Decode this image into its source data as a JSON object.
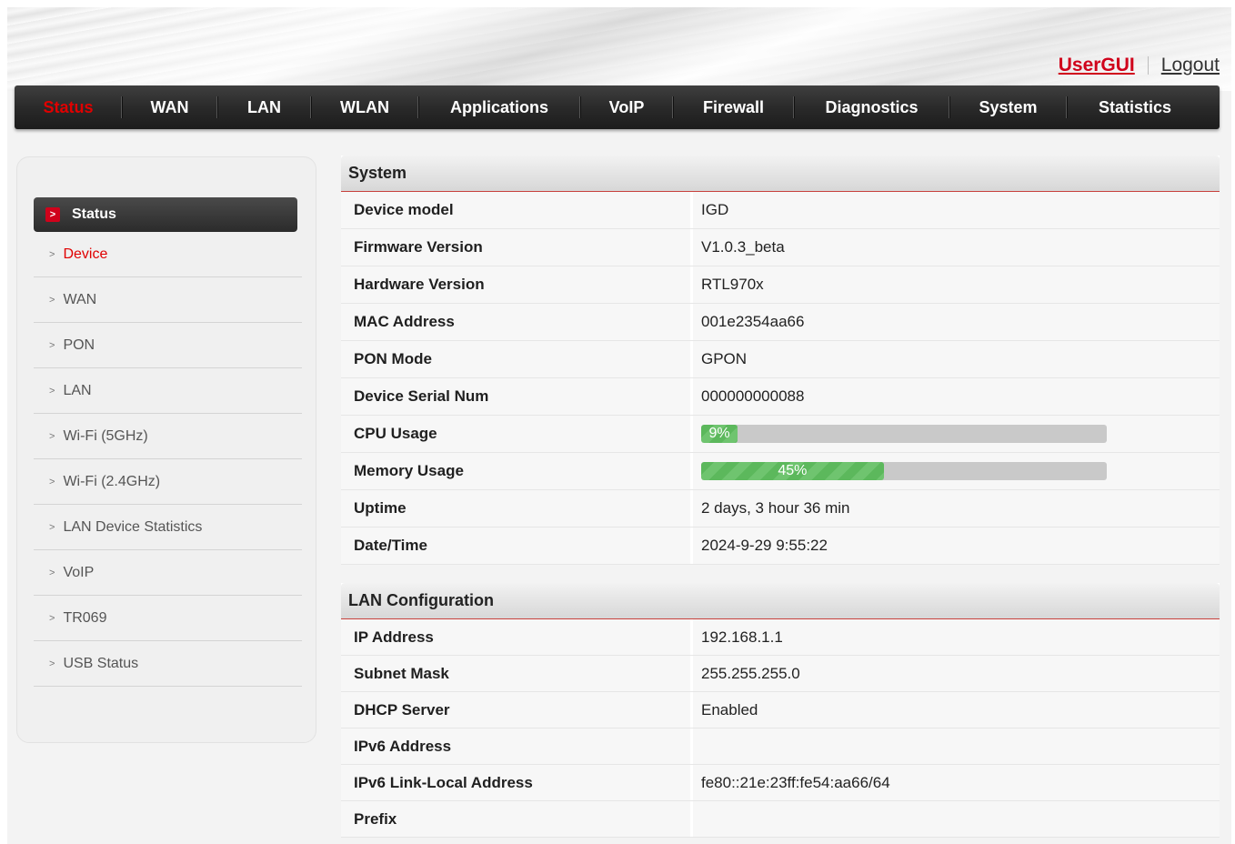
{
  "header": {
    "usergui_label": "UserGUI",
    "logout_label": "Logout"
  },
  "nav": {
    "items": [
      {
        "label": "Status",
        "active": true
      },
      {
        "label": "WAN"
      },
      {
        "label": "LAN"
      },
      {
        "label": "WLAN"
      },
      {
        "label": "Applications"
      },
      {
        "label": "VoIP"
      },
      {
        "label": "Firewall"
      },
      {
        "label": "Diagnostics"
      },
      {
        "label": "System"
      },
      {
        "label": "Statistics"
      }
    ]
  },
  "sidebar": {
    "heading": "Status",
    "items": [
      {
        "label": "Device",
        "active": true
      },
      {
        "label": "WAN"
      },
      {
        "label": "PON"
      },
      {
        "label": "LAN"
      },
      {
        "label": "Wi-Fi (5GHz)"
      },
      {
        "label": "Wi-Fi (2.4GHz)"
      },
      {
        "label": "LAN Device Statistics"
      },
      {
        "label": "VoIP"
      },
      {
        "label": "TR069"
      },
      {
        "label": "USB Status"
      }
    ]
  },
  "system": {
    "title": "System",
    "rows": [
      {
        "label": "Device model",
        "value": "IGD"
      },
      {
        "label": "Firmware Version",
        "value": "V1.0.3_beta"
      },
      {
        "label": "Hardware Version",
        "value": "RTL970x"
      },
      {
        "label": "MAC Address",
        "value": "001e2354aa66"
      },
      {
        "label": "PON Mode",
        "value": "GPON"
      },
      {
        "label": "Device Serial Num",
        "value": "000000000088"
      },
      {
        "label": "CPU Usage",
        "value": "9%",
        "percent": 9
      },
      {
        "label": "Memory Usage",
        "value": "45%",
        "percent": 45
      },
      {
        "label": "Uptime",
        "value": "2 days, 3 hour 36 min"
      },
      {
        "label": "Date/Time",
        "value": "2024-9-29 9:55:22"
      }
    ]
  },
  "lan": {
    "title": "LAN Configuration",
    "rows": [
      {
        "label": "IP Address",
        "value": "192.168.1.1"
      },
      {
        "label": "Subnet Mask",
        "value": "255.255.255.0"
      },
      {
        "label": "DHCP Server",
        "value": "Enabled"
      },
      {
        "label": "IPv6 Address",
        "value": ""
      },
      {
        "label": "IPv6 Link-Local Address",
        "value": "fe80::21e:23ff:fe54:aa66/64"
      },
      {
        "label": "Prefix",
        "value": ""
      }
    ]
  },
  "colors": {
    "accent": "#d0021b",
    "progress": "#5cb85c",
    "nav_bg": "#2a2a2a"
  }
}
